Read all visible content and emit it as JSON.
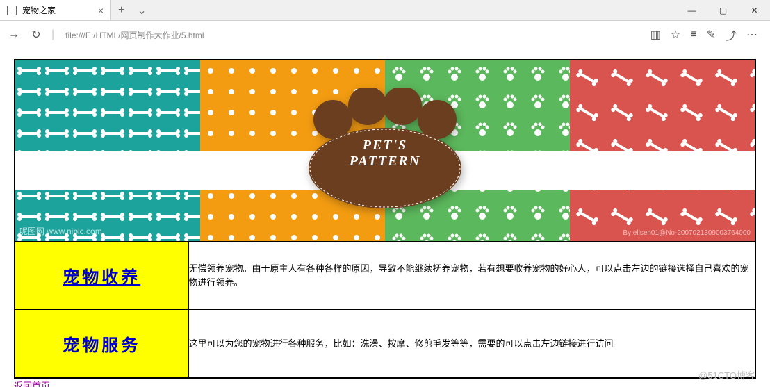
{
  "browser": {
    "tab_title": "宠物之家",
    "url": "file:///E:/HTML/网页制作大作业/5.html"
  },
  "banner": {
    "title_line1": "PET'S",
    "title_line2": "PATTERN",
    "watermark_left": "呢图网 www.nipic.com",
    "watermark_right": "By ellsen01@No-2007021309003764000"
  },
  "rows": [
    {
      "link_label": "宠物收养",
      "description": "无偿领养宠物。由于原主人有各种各样的原因，导致不能继续抚养宠物，若有想要收养宠物的好心人，可以点击左边的链接选择自己喜欢的宠物进行领养。"
    },
    {
      "link_label": "宠物服务",
      "description": "这里可以为您的宠物进行各种服务，比如：洗澡、按摩、修剪毛发等等，需要的可以点击左边链接进行访问。"
    }
  ],
  "back_link": "返回首页",
  "page_watermark": "@51CTO博客"
}
